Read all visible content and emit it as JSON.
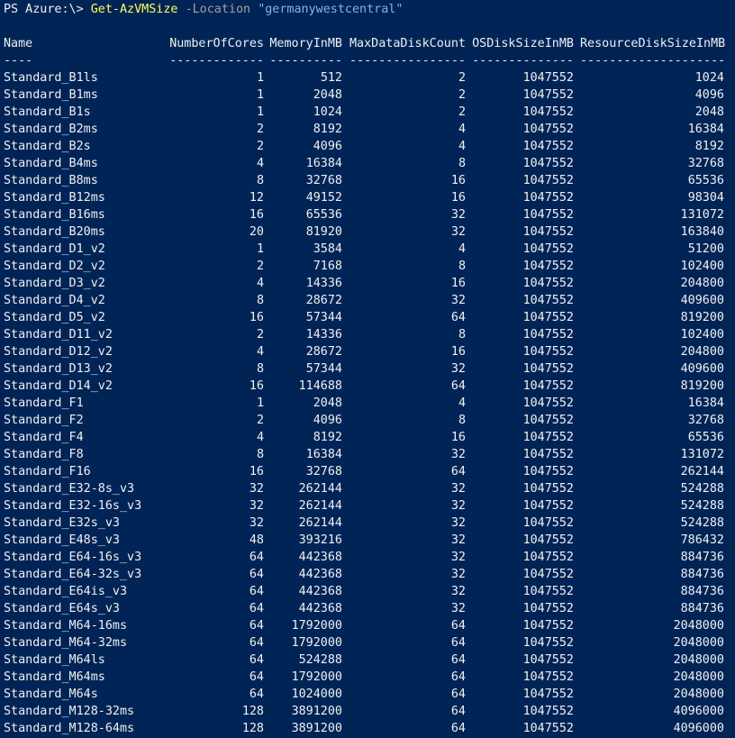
{
  "prompt": {
    "text": "PS Azure:\\> ",
    "command": "Get-AzVMSize",
    "param": "-Location",
    "value": "\"germanywestcentral\""
  },
  "table": {
    "headers": [
      "Name",
      "NumberOfCores",
      "MemoryInMB",
      "MaxDataDiskCount",
      "OSDiskSizeInMB",
      "ResourceDiskSizeInMB"
    ],
    "separators": [
      "----",
      "-------------",
      "----------",
      "----------------",
      "--------------",
      "--------------------"
    ],
    "rows": [
      [
        "Standard_B1ls",
        "1",
        "512",
        "2",
        "1047552",
        "1024"
      ],
      [
        "Standard_B1ms",
        "1",
        "2048",
        "2",
        "1047552",
        "4096"
      ],
      [
        "Standard_B1s",
        "1",
        "1024",
        "2",
        "1047552",
        "2048"
      ],
      [
        "Standard_B2ms",
        "2",
        "8192",
        "4",
        "1047552",
        "16384"
      ],
      [
        "Standard_B2s",
        "2",
        "4096",
        "4",
        "1047552",
        "8192"
      ],
      [
        "Standard_B4ms",
        "4",
        "16384",
        "8",
        "1047552",
        "32768"
      ],
      [
        "Standard_B8ms",
        "8",
        "32768",
        "16",
        "1047552",
        "65536"
      ],
      [
        "Standard_B12ms",
        "12",
        "49152",
        "16",
        "1047552",
        "98304"
      ],
      [
        "Standard_B16ms",
        "16",
        "65536",
        "32",
        "1047552",
        "131072"
      ],
      [
        "Standard_B20ms",
        "20",
        "81920",
        "32",
        "1047552",
        "163840"
      ],
      [
        "Standard_D1_v2",
        "1",
        "3584",
        "4",
        "1047552",
        "51200"
      ],
      [
        "Standard_D2_v2",
        "2",
        "7168",
        "8",
        "1047552",
        "102400"
      ],
      [
        "Standard_D3_v2",
        "4",
        "14336",
        "16",
        "1047552",
        "204800"
      ],
      [
        "Standard_D4_v2",
        "8",
        "28672",
        "32",
        "1047552",
        "409600"
      ],
      [
        "Standard_D5_v2",
        "16",
        "57344",
        "64",
        "1047552",
        "819200"
      ],
      [
        "Standard_D11_v2",
        "2",
        "14336",
        "8",
        "1047552",
        "102400"
      ],
      [
        "Standard_D12_v2",
        "4",
        "28672",
        "16",
        "1047552",
        "204800"
      ],
      [
        "Standard_D13_v2",
        "8",
        "57344",
        "32",
        "1047552",
        "409600"
      ],
      [
        "Standard_D14_v2",
        "16",
        "114688",
        "64",
        "1047552",
        "819200"
      ],
      [
        "Standard_F1",
        "1",
        "2048",
        "4",
        "1047552",
        "16384"
      ],
      [
        "Standard_F2",
        "2",
        "4096",
        "8",
        "1047552",
        "32768"
      ],
      [
        "Standard_F4",
        "4",
        "8192",
        "16",
        "1047552",
        "65536"
      ],
      [
        "Standard_F8",
        "8",
        "16384",
        "32",
        "1047552",
        "131072"
      ],
      [
        "Standard_F16",
        "16",
        "32768",
        "64",
        "1047552",
        "262144"
      ],
      [
        "Standard_E32-8s_v3",
        "32",
        "262144",
        "32",
        "1047552",
        "524288"
      ],
      [
        "Standard_E32-16s_v3",
        "32",
        "262144",
        "32",
        "1047552",
        "524288"
      ],
      [
        "Standard_E32s_v3",
        "32",
        "262144",
        "32",
        "1047552",
        "524288"
      ],
      [
        "Standard_E48s_v3",
        "48",
        "393216",
        "32",
        "1047552",
        "786432"
      ],
      [
        "Standard_E64-16s_v3",
        "64",
        "442368",
        "32",
        "1047552",
        "884736"
      ],
      [
        "Standard_E64-32s_v3",
        "64",
        "442368",
        "32",
        "1047552",
        "884736"
      ],
      [
        "Standard_E64is_v3",
        "64",
        "442368",
        "32",
        "1047552",
        "884736"
      ],
      [
        "Standard_E64s_v3",
        "64",
        "442368",
        "32",
        "1047552",
        "884736"
      ],
      [
        "Standard_M64-16ms",
        "64",
        "1792000",
        "64",
        "1047552",
        "2048000"
      ],
      [
        "Standard_M64-32ms",
        "64",
        "1792000",
        "64",
        "1047552",
        "2048000"
      ],
      [
        "Standard_M64ls",
        "64",
        "524288",
        "64",
        "1047552",
        "2048000"
      ],
      [
        "Standard_M64ms",
        "64",
        "1792000",
        "64",
        "1047552",
        "2048000"
      ],
      [
        "Standard_M64s",
        "64",
        "1024000",
        "64",
        "1047552",
        "2048000"
      ],
      [
        "Standard_M128-32ms",
        "128",
        "3891200",
        "64",
        "1047552",
        "4096000"
      ],
      [
        "Standard_M128-64ms",
        "128",
        "3891200",
        "64",
        "1047552",
        "4096000"
      ]
    ]
  },
  "colors": {
    "background": "#012456",
    "text": "#f0f0f0",
    "command": "#ffff60",
    "parameter": "#a0a0a0",
    "string": "#7eb5e6"
  }
}
